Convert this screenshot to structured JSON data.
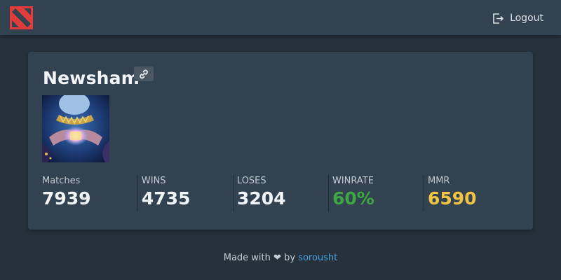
{
  "header": {
    "logo_icon": "dota-logo-icon",
    "logout_label": "Logout",
    "logout_icon": "logout-icon"
  },
  "profile": {
    "name": "Newsham",
    "link_icon": "link-icon",
    "avatar": "player-avatar-image"
  },
  "stats": [
    {
      "label": "Matches",
      "value": "7939"
    },
    {
      "label": "WINS",
      "value": "4735"
    },
    {
      "label": "LOSES",
      "value": "3204"
    },
    {
      "label": "WINRATE",
      "value": "60%",
      "color": "#3ea642"
    },
    {
      "label": "MMR",
      "value": "6590",
      "color": "#f1c543"
    }
  ],
  "footer": {
    "made_with": "Made with",
    "heart": "❤",
    "by": "by",
    "author": "sorousht"
  }
}
